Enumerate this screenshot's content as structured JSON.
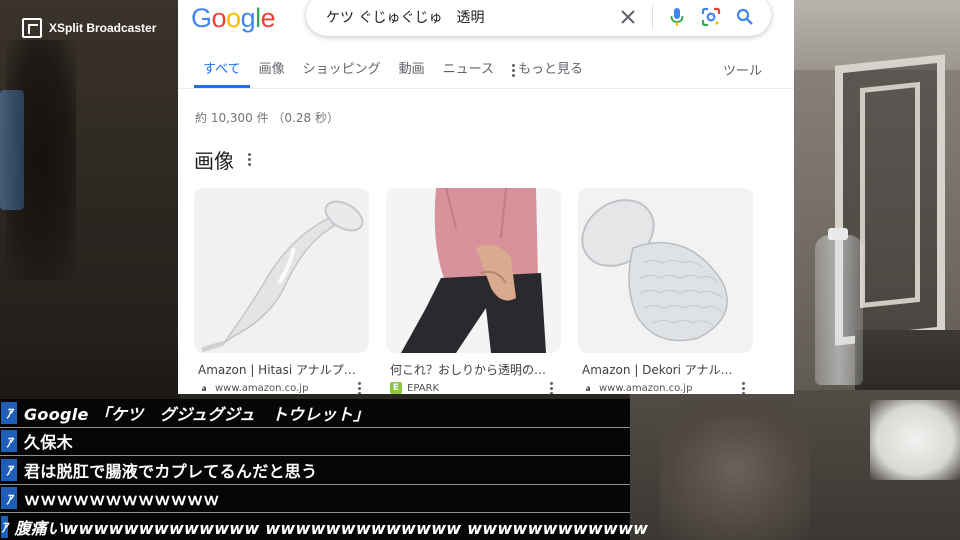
{
  "overlay": {
    "app_name": "XSplit Broadcaster"
  },
  "google": {
    "logo": [
      "G",
      "o",
      "o",
      "g",
      "l",
      "e"
    ],
    "search": {
      "query": "ケツ ぐじゅぐじゅ　透明",
      "icons": [
        "close-icon",
        "mic-icon",
        "lens-icon",
        "search-icon"
      ]
    },
    "tabs": [
      "すべて",
      "画像",
      "ショッピング",
      "動画",
      "ニュース"
    ],
    "more_label": "もっと見る",
    "tools_label": "ツール",
    "result_stats": "約 10,300 件 （0.28 秒）",
    "images_heading": "画像",
    "image_results": [
      {
        "title": "Amazon | Hitasi アナルプラ...",
        "source": "www.amazon.co.jp",
        "favicon": "a"
      },
      {
        "title": "何これ？おしりから透明の粘...",
        "source": "EPARK",
        "favicon": "E"
      },
      {
        "title": "Amazon | Dekori アナルディ...",
        "source": "www.amazon.co.jp",
        "favicon": "a"
      }
    ],
    "colors": {
      "accent": "#1a73e8",
      "text": "#202124",
      "muted": "#70757a"
    }
  },
  "comments": [
    {
      "badge": "ｱ",
      "text": "Google 「ケツ　グジュグジュ　トウレット」"
    },
    {
      "badge": "ｱ",
      "text": "久保木"
    },
    {
      "badge": "ｱ",
      "text": "君は脱肛で腸液でカプレてるんだと思う"
    },
    {
      "badge": "ｱ",
      "text": "ｗｗｗｗｗｗｗｗｗｗｗｗ"
    },
    {
      "badge": "ｱ",
      "text": "腹痛いwwwwwwwwwwwww wwwwwwwwwwwww wwwwwwwwwwww"
    }
  ]
}
